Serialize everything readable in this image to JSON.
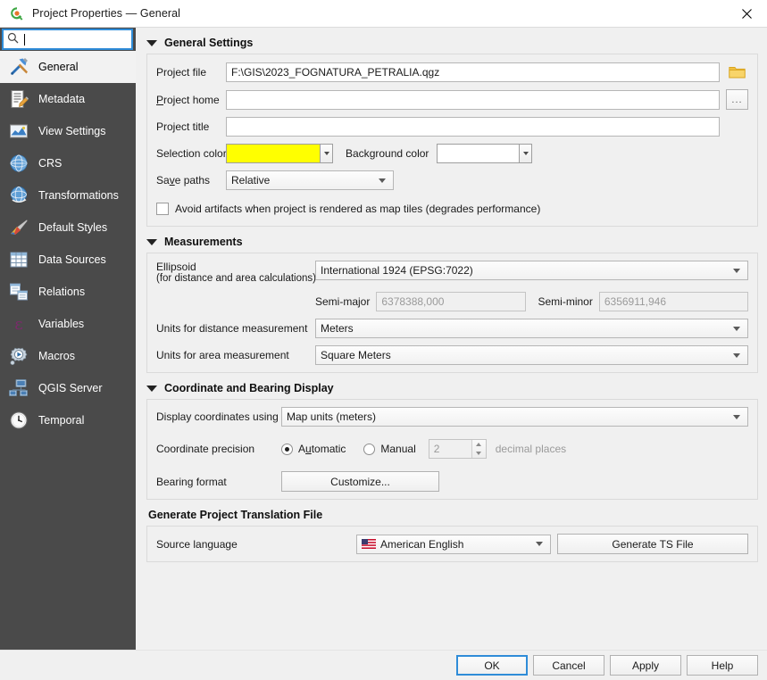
{
  "window": {
    "title": "Project Properties — General",
    "app_icon": "qgis-logo-icon",
    "close_icon": "close-icon"
  },
  "sidebar": {
    "search": {
      "placeholder": "",
      "value": "",
      "icon": "search-icon"
    },
    "items": [
      {
        "label": "General",
        "icon": "hammer-wrench-icon",
        "selected": true
      },
      {
        "label": "Metadata",
        "icon": "document-pencil-icon",
        "selected": false
      },
      {
        "label": "View Settings",
        "icon": "map-view-icon",
        "selected": false
      },
      {
        "label": "CRS",
        "icon": "globe-icon",
        "selected": false
      },
      {
        "label": "Transformations",
        "icon": "globe-transform-icon",
        "selected": false
      },
      {
        "label": "Default Styles",
        "icon": "paintbrush-icon",
        "selected": false
      },
      {
        "label": "Data Sources",
        "icon": "table-icon",
        "selected": false
      },
      {
        "label": "Relations",
        "icon": "relations-icon",
        "selected": false
      },
      {
        "label": "Variables",
        "icon": "epsilon-icon",
        "selected": false
      },
      {
        "label": "Macros",
        "icon": "gear-play-icon",
        "selected": false
      },
      {
        "label": "QGIS Server",
        "icon": "server-icon",
        "selected": false
      },
      {
        "label": "Temporal",
        "icon": "clock-icon",
        "selected": false
      }
    ]
  },
  "general_settings": {
    "title": "General Settings",
    "project_file": {
      "label": "Project file",
      "value": "F:\\GIS\\2023_FOGNATURA_PETRALIA.qgz",
      "browse_icon": "folder-icon"
    },
    "project_home": {
      "label": "Project home",
      "label_mnemonic": "P",
      "value": "",
      "browse_label": "..."
    },
    "project_title": {
      "label": "Project title",
      "value": ""
    },
    "selection_color": {
      "label": "Selection color",
      "color": "#ffff00"
    },
    "background_color": {
      "label": "Background color",
      "label_mnemonic": "g",
      "color": "#ffffff"
    },
    "save_paths": {
      "label": "Save paths",
      "label_mnemonic": "v",
      "value": "Relative"
    },
    "avoid_artifacts": {
      "label": "Avoid artifacts when project is rendered as map tiles (degrades performance)",
      "checked": false
    }
  },
  "measurements": {
    "title": "Measurements",
    "ellipsoid": {
      "label_line1": "Ellipsoid",
      "label_line2": "(for distance and area calculations)",
      "value": "International 1924 (EPSG:7022)"
    },
    "semi_major": {
      "label": "Semi-major",
      "value": "6378388,000",
      "enabled": false
    },
    "semi_minor": {
      "label": "Semi-minor",
      "value": "6356911,946",
      "enabled": false
    },
    "distance_units": {
      "label": "Units for distance measurement",
      "value": "Meters"
    },
    "area_units": {
      "label": "Units for area measurement",
      "value": "Square Meters"
    }
  },
  "coordinate_display": {
    "title": "Coordinate and Bearing Display",
    "display_coordinates": {
      "label": "Display coordinates using",
      "value": "Map units (meters)"
    },
    "coordinate_precision": {
      "label": "Coordinate precision",
      "automatic_label": "Automatic",
      "automatic_mnemonic": "u",
      "manual_label": "Manual",
      "selected": "Automatic",
      "decimal_places_value": "2",
      "decimal_places_label": "decimal places"
    },
    "bearing_format": {
      "label": "Bearing format",
      "button_label": "Customize..."
    }
  },
  "translation": {
    "title": "Generate Project Translation File",
    "source_language": {
      "label": "Source language",
      "value": "American English",
      "flag_icon": "us-flag-icon"
    },
    "generate_button": "Generate TS File"
  },
  "footer": {
    "ok": "OK",
    "cancel": "Cancel",
    "apply": "Apply",
    "help": "Help"
  }
}
